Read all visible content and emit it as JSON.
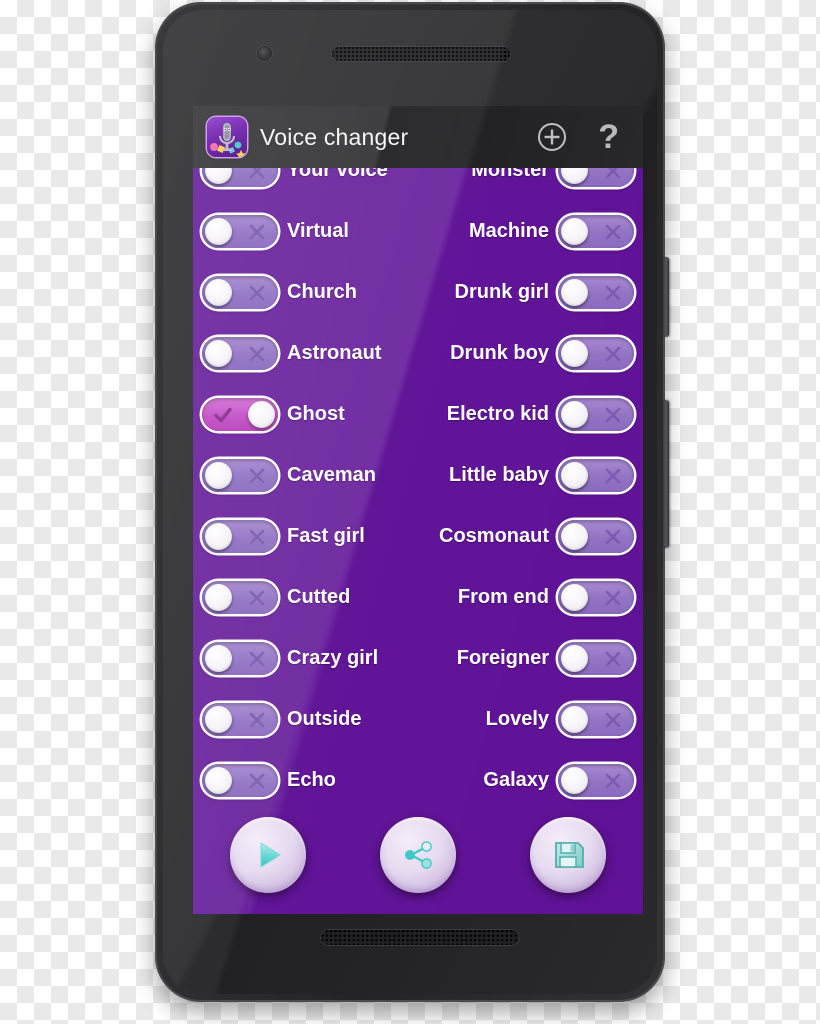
{
  "app": {
    "title": "Voice changer",
    "icon_name": "microphone-app-icon",
    "add_icon": "plus-circle-icon",
    "help_icon": "question-mark-icon",
    "help_label": "?"
  },
  "theme": {
    "background": "#5F1296",
    "appbar": "#2B2B2D",
    "toggle_off_track": "#9274C4",
    "toggle_on_track": "#C450C6",
    "knob": "#F7F4F8",
    "label_text": "#FFFFFF",
    "action_icon": "#3FC9C6"
  },
  "effects": [
    {
      "left": {
        "label": "Your voice",
        "state": "off"
      },
      "right": {
        "label": "Monster",
        "state": "off"
      }
    },
    {
      "left": {
        "label": "Virtual",
        "state": "off"
      },
      "right": {
        "label": "Machine",
        "state": "off"
      }
    },
    {
      "left": {
        "label": "Church",
        "state": "off"
      },
      "right": {
        "label": "Drunk girl",
        "state": "off"
      }
    },
    {
      "left": {
        "label": "Astronaut",
        "state": "off"
      },
      "right": {
        "label": "Drunk boy",
        "state": "off"
      }
    },
    {
      "left": {
        "label": "Ghost",
        "state": "on"
      },
      "right": {
        "label": "Electro kid",
        "state": "off"
      }
    },
    {
      "left": {
        "label": "Caveman",
        "state": "off"
      },
      "right": {
        "label": "Little baby",
        "state": "off"
      }
    },
    {
      "left": {
        "label": "Fast girl",
        "state": "off"
      },
      "right": {
        "label": "Cosmonaut",
        "state": "off"
      }
    },
    {
      "left": {
        "label": "Cutted",
        "state": "off"
      },
      "right": {
        "label": "From end",
        "state": "off"
      }
    },
    {
      "left": {
        "label": "Crazy girl",
        "state": "off"
      },
      "right": {
        "label": "Foreigner",
        "state": "off"
      }
    },
    {
      "left": {
        "label": "Outside",
        "state": "off"
      },
      "right": {
        "label": "Lovely",
        "state": "off"
      }
    },
    {
      "left": {
        "label": "Echo",
        "state": "off"
      },
      "right": {
        "label": "Galaxy",
        "state": "off"
      }
    }
  ],
  "actions": [
    {
      "name": "play-button",
      "icon": "play-icon"
    },
    {
      "name": "share-button",
      "icon": "share-icon"
    },
    {
      "name": "save-button",
      "icon": "floppy-disk-save-icon"
    }
  ],
  "device": {
    "camera_icon": "front-camera-icon",
    "earpiece_icon": "earpiece-speaker-icon",
    "bottom_speaker_icon": "bottom-speaker-icon",
    "power_button": "power-button",
    "volume_button": "volume-rocker-button"
  }
}
